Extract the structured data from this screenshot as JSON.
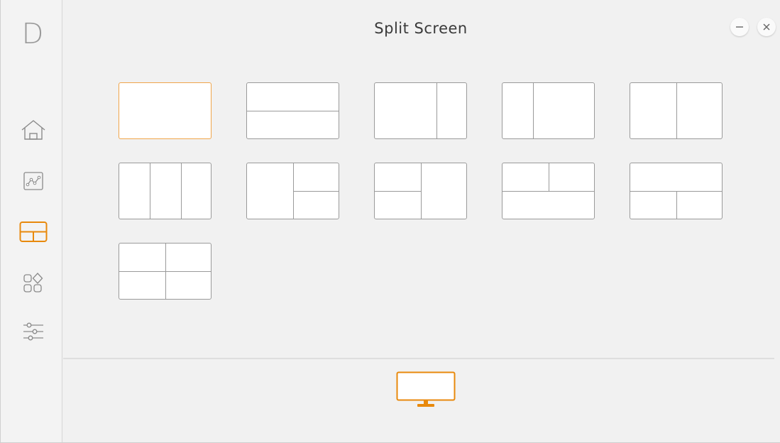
{
  "window": {
    "title": "Split Screen",
    "controls": [
      "minimize-icon",
      "close-icon"
    ]
  },
  "sidebar": {
    "logo": "D",
    "items": [
      {
        "name": "home",
        "icon": "home-icon",
        "active": false
      },
      {
        "name": "chart",
        "icon": "line-chart-icon",
        "active": false
      },
      {
        "name": "split-screen",
        "icon": "split-layout-icon",
        "active": true
      },
      {
        "name": "apps",
        "icon": "apps-grid-icon",
        "active": false
      },
      {
        "name": "settings",
        "icon": "sliders-icon",
        "active": false
      }
    ]
  },
  "layouts": [
    {
      "id": "single",
      "selected": true
    },
    {
      "id": "top-bottom"
    },
    {
      "id": "wide-left-narrow-right"
    },
    {
      "id": "narrow-left-wide-right"
    },
    {
      "id": "left-right"
    },
    {
      "id": "three-columns"
    },
    {
      "id": "left-plus-two-right"
    },
    {
      "id": "two-left-plus-right"
    },
    {
      "id": "two-top-plus-bottom"
    },
    {
      "id": "top-plus-two-bottom"
    },
    {
      "id": "four-grid"
    }
  ],
  "display": {
    "icon": "monitor-icon",
    "active": true
  },
  "colors": {
    "accent": "#f0a54a",
    "accent_dark": "#e8890c",
    "icon": "#8a8a8a",
    "border": "#9a9a9a"
  }
}
